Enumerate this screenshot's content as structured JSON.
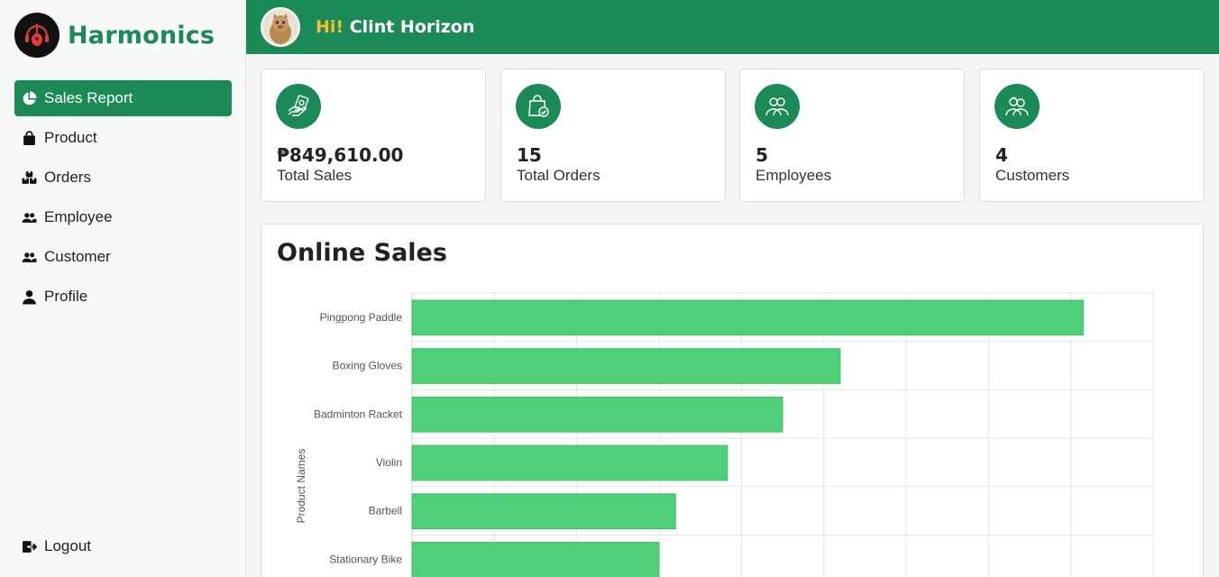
{
  "brand": {
    "name": "Harmonics"
  },
  "sidebar": {
    "items": [
      {
        "label": "Sales Report",
        "icon": "pie-chart-icon",
        "active": true
      },
      {
        "label": "Product",
        "icon": "shopping-bag-icon",
        "active": false
      },
      {
        "label": "Orders",
        "icon": "boxes-icon",
        "active": false
      },
      {
        "label": "Employee",
        "icon": "users-icon",
        "active": false
      },
      {
        "label": "Customer",
        "icon": "users-icon",
        "active": false
      },
      {
        "label": "Profile",
        "icon": "user-icon",
        "active": false
      }
    ],
    "logout": {
      "label": "Logout",
      "icon": "logout-icon"
    }
  },
  "header": {
    "hi": "Hi!",
    "name": "Clint Horizon"
  },
  "stats": [
    {
      "value": "₱849,610.00",
      "label": "Total Sales",
      "icon": "money-hand-icon"
    },
    {
      "value": "15",
      "label": "Total Orders",
      "icon": "shopping-bag-check-icon"
    },
    {
      "value": "5",
      "label": "Employees",
      "icon": "people-icon"
    },
    {
      "value": "4",
      "label": "Customers",
      "icon": "customers-icon"
    }
  ],
  "panel": {
    "title": "Online Sales"
  },
  "colors": {
    "accent": "#1b8a56",
    "bar": "#4ecf78",
    "greet": "#f2c12e"
  },
  "chart_data": {
    "type": "bar",
    "orientation": "horizontal",
    "ylabel": "Product Names",
    "categories": [
      "Pingpong Paddle",
      "Boxing Gloves",
      "Badminton Racket",
      "Violin",
      "Barbell",
      "Stationary Bike"
    ],
    "values": [
      81.5,
      52,
      45,
      38.3,
      32,
      30
    ],
    "xlim": [
      0,
      90
    ],
    "grid": true
  }
}
